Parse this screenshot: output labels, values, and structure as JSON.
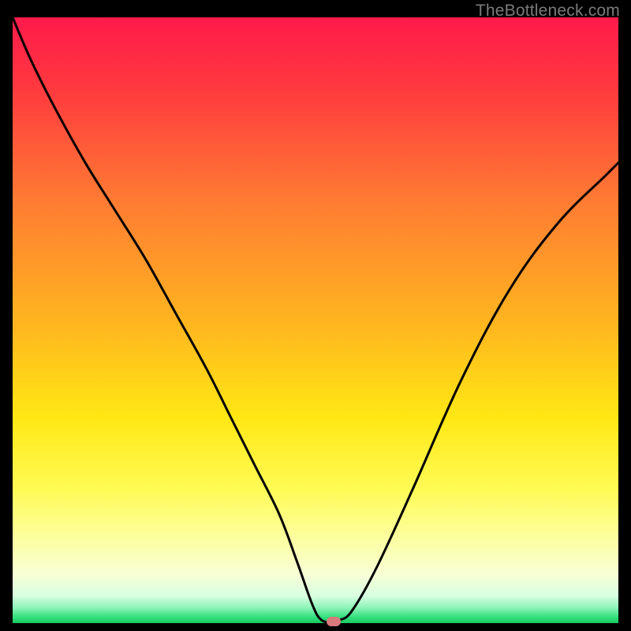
{
  "watermark": "TheBottleneck.com",
  "chart_data": {
    "type": "line",
    "title": "",
    "xlabel": "",
    "ylabel": "",
    "xlim": [
      0,
      100
    ],
    "ylim": [
      0,
      100
    ],
    "background_gradient": {
      "stops": [
        {
          "offset": 0.0,
          "color": "#ff1a4b"
        },
        {
          "offset": 0.12,
          "color": "#ff3a3f"
        },
        {
          "offset": 0.3,
          "color": "#ff7a33"
        },
        {
          "offset": 0.5,
          "color": "#ffb420"
        },
        {
          "offset": 0.66,
          "color": "#ffe714"
        },
        {
          "offset": 0.78,
          "color": "#fffb56"
        },
        {
          "offset": 0.86,
          "color": "#fcffa0"
        },
        {
          "offset": 0.92,
          "color": "#f7ffd6"
        },
        {
          "offset": 0.955,
          "color": "#d8ffe1"
        },
        {
          "offset": 0.975,
          "color": "#8cf2b7"
        },
        {
          "offset": 0.99,
          "color": "#33e07f"
        },
        {
          "offset": 1.0,
          "color": "#18c95e"
        }
      ]
    },
    "series": [
      {
        "name": "bottleneck-curve",
        "color": "#000000",
        "x": [
          0,
          3,
          7,
          12,
          17,
          22,
          27,
          32,
          36,
          40,
          44,
          47,
          49.5,
          51,
          53,
          54,
          56,
          60,
          66,
          74,
          82,
          90,
          98,
          100
        ],
        "y": [
          100,
          93,
          85,
          76,
          68,
          60,
          51,
          42,
          34,
          26,
          18,
          10,
          3,
          0.5,
          0.2,
          0.5,
          2,
          9,
          22,
          40,
          55,
          66,
          74,
          76
        ]
      }
    ],
    "marker": {
      "x": 53,
      "y": 0.3,
      "color": "#d87a7c"
    }
  }
}
